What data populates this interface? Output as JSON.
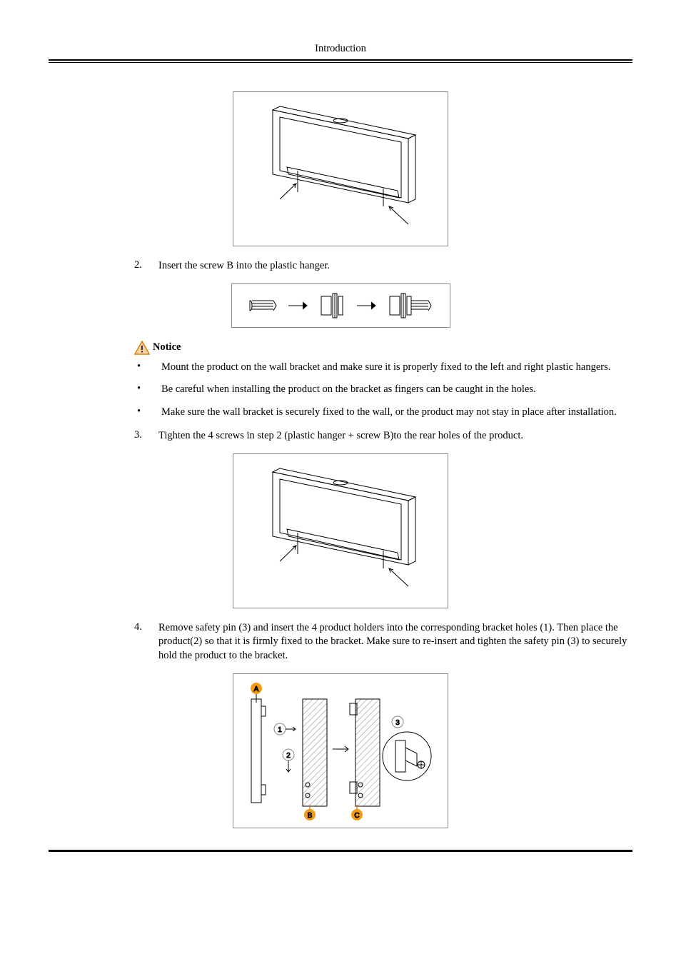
{
  "header": {
    "title": "Introduction"
  },
  "steps": {
    "s2": {
      "num": "2.",
      "text": "Insert the screw B into the plastic hanger."
    },
    "s3": {
      "num": "3.",
      "text": "Tighten the 4 screws in step 2 (plastic hanger + screw B)to the rear holes of the product."
    },
    "s4": {
      "num": "4.",
      "text": "Remove safety pin (3) and insert the 4 product holders into the corresponding bracket holes (1). Then place the product(2) so that it is firmly fixed to the bracket. Make sure to re-insert and tighten the safety pin (3) to securely hold the product to the bracket."
    }
  },
  "notice": {
    "label": "Notice",
    "items": [
      "Mount the product on the wall bracket and make sure it is properly fixed to the left and right plastic hangers.",
      "Be careful when installing the product on the bracket as fingers can be caught in the holes.",
      "Make sure the wall bracket is securely fixed to the wall, or the product may not stay in place after installation."
    ]
  },
  "labels": {
    "A": "A",
    "B": "B",
    "C": "C",
    "n1": "1",
    "n2": "2",
    "n3": "3"
  }
}
